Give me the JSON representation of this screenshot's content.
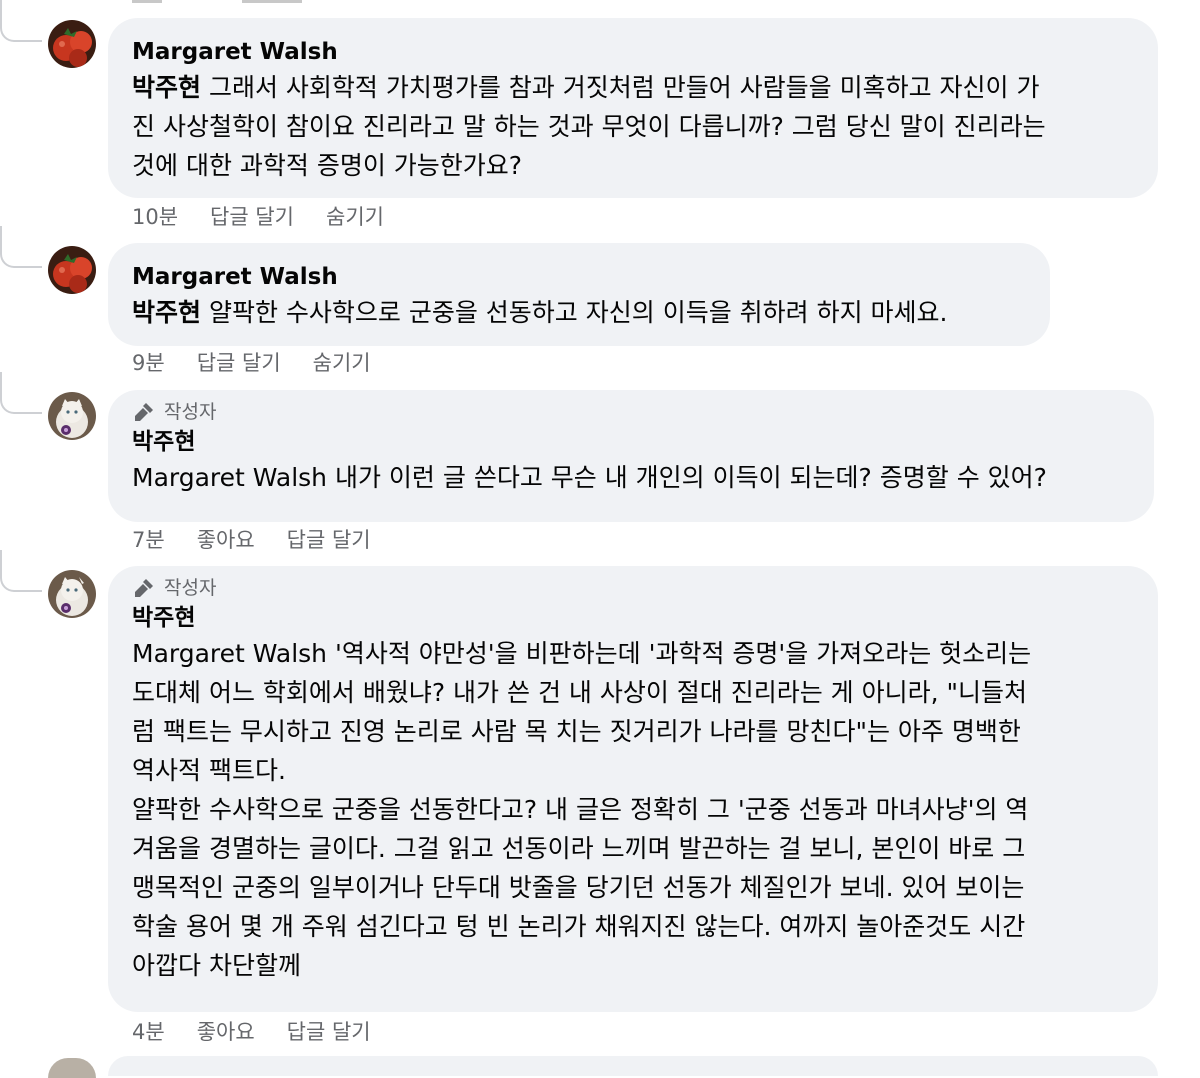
{
  "comments": [
    {
      "avatar": "tomato-avatar",
      "author": "Margaret Walsh",
      "mention": "박주현",
      "lines": [
        " 그래서 사회학적 가치평가를 참과 거짓처럼 만들어 사람들을 미혹하고 자신이 가",
        "진 사상철학이 참이요 진리라고 말 하는 것과 무엇이 다릅니까? 그럼 당신 말이 진리라는",
        "것에 대한 과학적 증명이 가능한가요?"
      ],
      "time": "10분",
      "reply": "답글 달기",
      "hide": "숨기기"
    },
    {
      "avatar": "tomato-avatar",
      "author": "Margaret Walsh",
      "mention": "박주현",
      "lines": [
        " 얄팍한 수사학으로 군중을 선동하고 자신의 이득을 취하려 하지 마세요."
      ],
      "time": "9분",
      "reply": "답글 달기",
      "hide": "숨기기"
    },
    {
      "avatar": "cat-avatar",
      "badge": "작성자",
      "author": "박주현",
      "lines": [
        "Margaret Walsh 내가 이런 글 쓴다고 무슨 내 개인의 이득이 되는데? 증명할 수 있어?"
      ],
      "time": "7분",
      "like": "좋아요",
      "reply": "답글 달기"
    },
    {
      "avatar": "cat-avatar",
      "badge": "작성자",
      "author": "박주현",
      "lines": [
        "Margaret Walsh '역사적 야만성'을 비판하는데 '과학적 증명'을 가져오라는 헛소리는",
        "도대체 어느 학회에서 배웠냐? 내가 쓴 건 내 사상이 절대 진리라는 게 아니라, \"니들처",
        "럼 팩트는 무시하고 진영 논리로 사람 목 치는 짓거리가 나라를 망친다\"는 아주 명백한",
        "역사적 팩트다.",
        "얄팍한 수사학으로 군중을 선동한다고? 내 글은 정확히 그 '군중 선동과 마녀사냥'의 역",
        "겨움을 경멸하는 글이다. 그걸 읽고 선동이라 느끼며 발끈하는 걸 보니, 본인이 바로 그",
        "맹목적인 군중의 일부이거나 단두대 밧줄을 당기던 선동가 체질인가 보네. 있어 보이는",
        "학술 용어 몇 개 주워 섬긴다고 텅 빈 논리가 채워지진 않는다. 여까지 놀아준것도 시간",
        "아깝다 차단할께"
      ],
      "time": "4분",
      "like": "좋아요",
      "reply": "답글 달기"
    }
  ],
  "colors": {
    "bubble": "#f0f2f5",
    "meta": "#65676b",
    "text": "#050505"
  }
}
